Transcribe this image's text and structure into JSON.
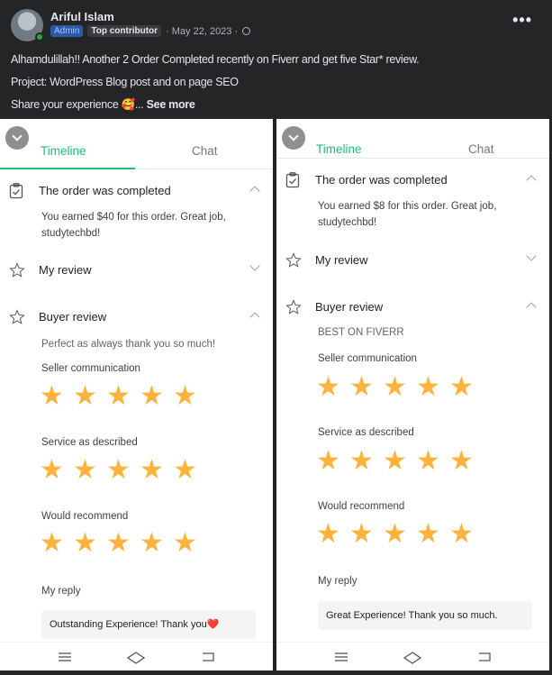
{
  "post": {
    "author": "Ariful Islam",
    "badges": {
      "admin": "Admin",
      "contributor": "Top contributor"
    },
    "date": "· May 22, 2023 ·",
    "lines": [
      "Alhamdulillah!!  Another 2 Order Completed recently on Fiverr and get five Star* review.",
      "Project: WordPress Blog post and on page SEO",
      "Share your experience 🥰..."
    ],
    "see_more": "See more",
    "more_icon": "•••"
  },
  "left": {
    "tabs": {
      "timeline": "Timeline",
      "chat": "Chat"
    },
    "completed": {
      "title": "The order was completed",
      "line1": "You earned $40 for this order. Great job,",
      "line2": "studytechbd!"
    },
    "my_review": "My review",
    "buyer_review": {
      "title": "Buyer review",
      "comment": "Perfect as always thank you so much!",
      "seller_communication": "Seller communication",
      "seller_communication_rating": 5,
      "service_as_described": "Service as described",
      "service_as_described_rating": 5,
      "would_recommend": "Would recommend",
      "would_recommend_rating": 5
    },
    "my_reply": "My reply",
    "reply_text": "Outstanding Experience! Thank you",
    "reply_emoji": "❤️"
  },
  "right": {
    "tabs": {
      "timeline": "Timeline",
      "chat": "Chat"
    },
    "completed": {
      "title": "The order was completed",
      "line1": "You earned $8 for this order. Great job,",
      "line2": "studytechbd!"
    },
    "my_review": "My review",
    "buyer_review": {
      "title": "Buyer review",
      "comment": "BEST ON FIVERR",
      "seller_communication": "Seller communication",
      "seller_communication_rating": 5,
      "service_as_described": "Service as described",
      "service_as_described_rating": 5,
      "would_recommend": "Would recommend",
      "would_recommend_rating": 5
    },
    "my_reply": "My reply",
    "reply_text": "Great Experience! Thank you so much."
  },
  "colors": {
    "accent": "#1dbf73",
    "star": "#ffb33e",
    "dark_bg": "#242526"
  }
}
